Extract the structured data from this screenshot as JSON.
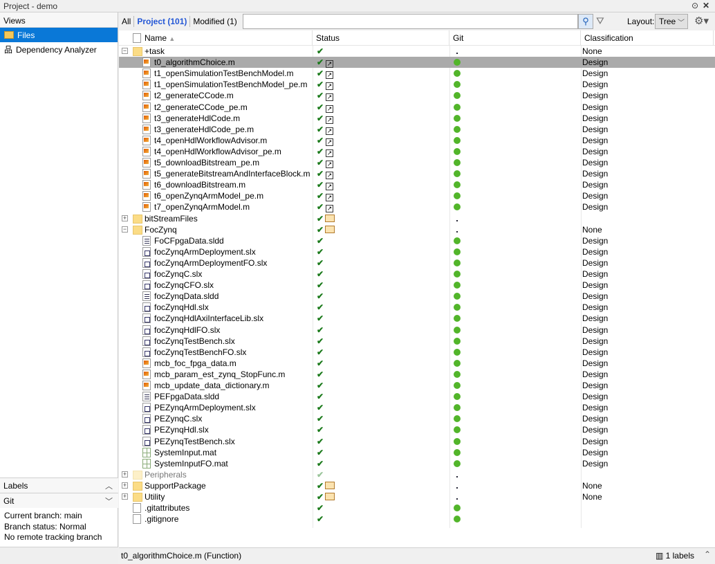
{
  "window": {
    "title": "Project - demo"
  },
  "views": {
    "header": "Views",
    "items": [
      {
        "label": "Files",
        "icon": "folder-open-icon",
        "selected": true
      },
      {
        "label": "Dependency Analyzer",
        "icon": "hierarchy-icon",
        "selected": false
      }
    ]
  },
  "panels": {
    "labels": "Labels",
    "git": "Git",
    "git_info": [
      "Current branch: main",
      "Branch status: Normal",
      "No remote tracking branch"
    ]
  },
  "toolbar": {
    "all": "All",
    "project": "Project (101)",
    "modified": "Modified (1)",
    "search_value": "",
    "layout_label": "Layout:",
    "layout_value": "Tree"
  },
  "columns": [
    "Name",
    "Status",
    "Git",
    "Classification"
  ],
  "rows": [
    {
      "name": "+task",
      "type": "folder",
      "level": 0,
      "expand": "-",
      "status": "check",
      "git": "small",
      "cls": "None"
    },
    {
      "name": "t0_algorithmChoice.m",
      "type": "m",
      "level": 1,
      "status": "check-short",
      "git": "green",
      "cls": "Design",
      "selected": true
    },
    {
      "name": "t1_openSimulationTestBenchModel.m",
      "type": "m",
      "level": 1,
      "status": "check-short",
      "git": "green",
      "cls": "Design"
    },
    {
      "name": "t1_openSimulationTestBenchModel_pe.m",
      "type": "m",
      "level": 1,
      "status": "check-short",
      "git": "green",
      "cls": "Design"
    },
    {
      "name": "t2_generateCCode.m",
      "type": "m",
      "level": 1,
      "status": "check-short",
      "git": "green",
      "cls": "Design"
    },
    {
      "name": "t2_generateCCode_pe.m",
      "type": "m",
      "level": 1,
      "status": "check-short",
      "git": "green",
      "cls": "Design"
    },
    {
      "name": "t3_generateHdlCode.m",
      "type": "m",
      "level": 1,
      "status": "check-short",
      "git": "green",
      "cls": "Design"
    },
    {
      "name": "t3_generateHdlCode_pe.m",
      "type": "m",
      "level": 1,
      "status": "check-short",
      "git": "green",
      "cls": "Design"
    },
    {
      "name": "t4_openHdlWorkflowAdvisor.m",
      "type": "m",
      "level": 1,
      "status": "check-short",
      "git": "green",
      "cls": "Design"
    },
    {
      "name": "t4_openHdlWorkflowAdvisor_pe.m",
      "type": "m",
      "level": 1,
      "status": "check-short",
      "git": "green",
      "cls": "Design"
    },
    {
      "name": "t5_downloadBitstream_pe.m",
      "type": "m",
      "level": 1,
      "status": "check-short",
      "git": "green",
      "cls": "Design"
    },
    {
      "name": "t5_generateBitstreamAndInterfaceBlock.m",
      "type": "m",
      "level": 1,
      "status": "check-short",
      "git": "green",
      "cls": "Design"
    },
    {
      "name": "t6_downloadBitstream.m",
      "type": "m",
      "level": 1,
      "status": "check-short",
      "git": "green",
      "cls": "Design"
    },
    {
      "name": "t6_openZynqArmModel_pe.m",
      "type": "m",
      "level": 1,
      "status": "check-short",
      "git": "green",
      "cls": "Design"
    },
    {
      "name": "t7_openZynqArmModel.m",
      "type": "m",
      "level": 1,
      "status": "check-short",
      "git": "green",
      "cls": "Design"
    },
    {
      "name": "bitStreamFiles",
      "type": "folder",
      "level": 0,
      "expand": "+",
      "status": "check-folder",
      "git": "small",
      "cls": ""
    },
    {
      "name": "FocZynq",
      "type": "folder",
      "level": 0,
      "expand": "-",
      "status": "check-folder",
      "git": "small",
      "cls": "None"
    },
    {
      "name": "FoCFpgaData.sldd",
      "type": "sldd",
      "level": 1,
      "status": "check",
      "git": "green",
      "cls": "Design"
    },
    {
      "name": "focZynqArmDeployment.slx",
      "type": "slx",
      "level": 1,
      "status": "check",
      "git": "green",
      "cls": "Design"
    },
    {
      "name": "focZynqArmDeploymentFO.slx",
      "type": "slx",
      "level": 1,
      "status": "check",
      "git": "green",
      "cls": "Design"
    },
    {
      "name": "focZynqC.slx",
      "type": "slx",
      "level": 1,
      "status": "check",
      "git": "green",
      "cls": "Design"
    },
    {
      "name": "focZynqCFO.slx",
      "type": "slx",
      "level": 1,
      "status": "check",
      "git": "green",
      "cls": "Design"
    },
    {
      "name": "focZynqData.sldd",
      "type": "sldd",
      "level": 1,
      "status": "check",
      "git": "green",
      "cls": "Design"
    },
    {
      "name": "focZynqHdl.slx",
      "type": "slx",
      "level": 1,
      "status": "check",
      "git": "green",
      "cls": "Design"
    },
    {
      "name": "focZynqHdlAxiInterfaceLib.slx",
      "type": "slx",
      "level": 1,
      "status": "check",
      "git": "green",
      "cls": "Design"
    },
    {
      "name": "focZynqHdlFO.slx",
      "type": "slx",
      "level": 1,
      "status": "check",
      "git": "green",
      "cls": "Design"
    },
    {
      "name": "focZynqTestBench.slx",
      "type": "slx",
      "level": 1,
      "status": "check",
      "git": "green",
      "cls": "Design"
    },
    {
      "name": "focZynqTestBenchFO.slx",
      "type": "slx",
      "level": 1,
      "status": "check",
      "git": "green",
      "cls": "Design"
    },
    {
      "name": "mcb_foc_fpga_data.m",
      "type": "m",
      "level": 1,
      "status": "check",
      "git": "green",
      "cls": "Design"
    },
    {
      "name": "mcb_param_est_zynq_StopFunc.m",
      "type": "m",
      "level": 1,
      "status": "check",
      "git": "green",
      "cls": "Design"
    },
    {
      "name": "mcb_update_data_dictionary.m",
      "type": "m",
      "level": 1,
      "status": "check",
      "git": "green",
      "cls": "Design"
    },
    {
      "name": "PEFpgaData.sldd",
      "type": "sldd",
      "level": 1,
      "status": "check",
      "git": "green",
      "cls": "Design"
    },
    {
      "name": "PEZynqArmDeployment.slx",
      "type": "slx",
      "level": 1,
      "status": "check",
      "git": "green",
      "cls": "Design"
    },
    {
      "name": "PEZynqC.slx",
      "type": "slx",
      "level": 1,
      "status": "check",
      "git": "green",
      "cls": "Design"
    },
    {
      "name": "PEZynqHdl.slx",
      "type": "slx",
      "level": 1,
      "status": "check",
      "git": "green",
      "cls": "Design"
    },
    {
      "name": "PEZynqTestBench.slx",
      "type": "slx",
      "level": 1,
      "status": "check",
      "git": "green",
      "cls": "Design"
    },
    {
      "name": "SystemInput.mat",
      "type": "mat",
      "level": 1,
      "status": "check",
      "git": "green",
      "cls": "Design"
    },
    {
      "name": "SystemInputFO.mat",
      "type": "mat",
      "level": 1,
      "status": "check",
      "git": "green",
      "cls": "Design"
    },
    {
      "name": "Peripherals",
      "type": "folder",
      "level": 0,
      "expand": "+",
      "status": "check",
      "git": "small",
      "cls": "",
      "dim": true
    },
    {
      "name": "SupportPackage",
      "type": "folder",
      "level": 0,
      "expand": "+",
      "status": "check-folder",
      "git": "small",
      "cls": "None"
    },
    {
      "name": "Utility",
      "type": "folder",
      "level": 0,
      "expand": "+",
      "status": "check-folder",
      "git": "small",
      "cls": "None"
    },
    {
      "name": ".gitattributes",
      "type": "file",
      "level": 0,
      "status": "check",
      "git": "green",
      "cls": ""
    },
    {
      "name": ".gitignore",
      "type": "file",
      "level": 0,
      "status": "check",
      "git": "green",
      "cls": ""
    }
  ],
  "statusbar": {
    "selection": "t0_algorithmChoice.m (Function)",
    "labels": "1 labels"
  },
  "colors": {
    "selection": "#0a78d7",
    "project_tab": "#2457d6",
    "git_green": "#52b52a"
  }
}
